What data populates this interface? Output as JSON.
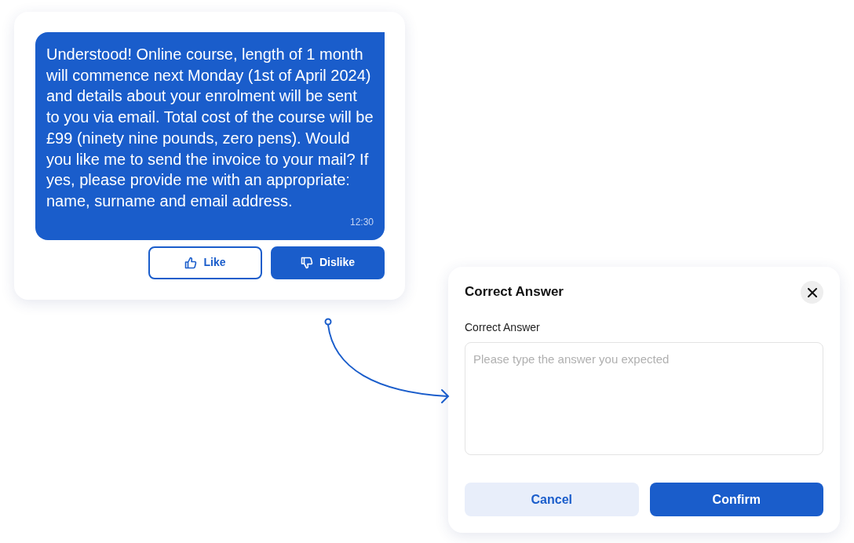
{
  "message": {
    "text": "Understood! Online course, length of 1 month will commence next Monday (1st of April 2024) and details about your enrolment will be sent to you via email. Total cost of the course will be £99 (ninety nine pounds, zero pens). Would you like me to send the invoice to your mail? If yes, please provide me with an appropriate: name, surname and email address.",
    "time": "12:30"
  },
  "reactions": [
    {
      "kind": "like",
      "label": "Like",
      "selected": false
    },
    {
      "kind": "dislike",
      "label": "Dislike",
      "selected": true
    }
  ],
  "dialog": {
    "title": "Correct Answer",
    "field_label": "Correct Answer",
    "placeholder": "Please type the answer you expected",
    "buttons": [
      {
        "kind": "secondary",
        "label": "Cancel"
      },
      {
        "kind": "primary",
        "label": "Confirm"
      }
    ]
  }
}
